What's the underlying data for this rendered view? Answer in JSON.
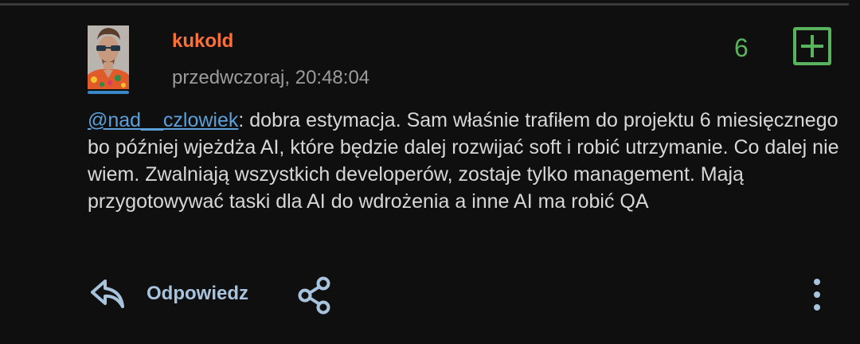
{
  "comment": {
    "author": "kukold",
    "timestamp": "przedwczoraj, 20:48:04",
    "votes": "6",
    "mention": "@nad__czlowiek",
    "body": ": dobra estymacja. Sam właśnie trafiłem do projektu 6 miesięcznego bo później wjeżdża AI, które będzie dalej rozwijać soft i robić utrzymanie. Co dalej nie wiem. Zwalniają wszystkich developerów, zostaje tylko management. Mają przygotowywać taski dla AI do wdrożenia a inne AI ma robić QA"
  },
  "actions": {
    "reply_label": "Odpowiedz",
    "reply_icon": "reply-icon",
    "share_icon": "share-icon",
    "more_icon": "more-vertical-icon",
    "upvote_icon": "plus-icon"
  },
  "colors": {
    "background": "#0f0f10",
    "author": "#ff6f38",
    "vote": "#58b35c",
    "mention": "#5ba0d8",
    "icon": "#a8c4dc",
    "text": "#d7d7d7",
    "muted": "#9c9c9c"
  }
}
